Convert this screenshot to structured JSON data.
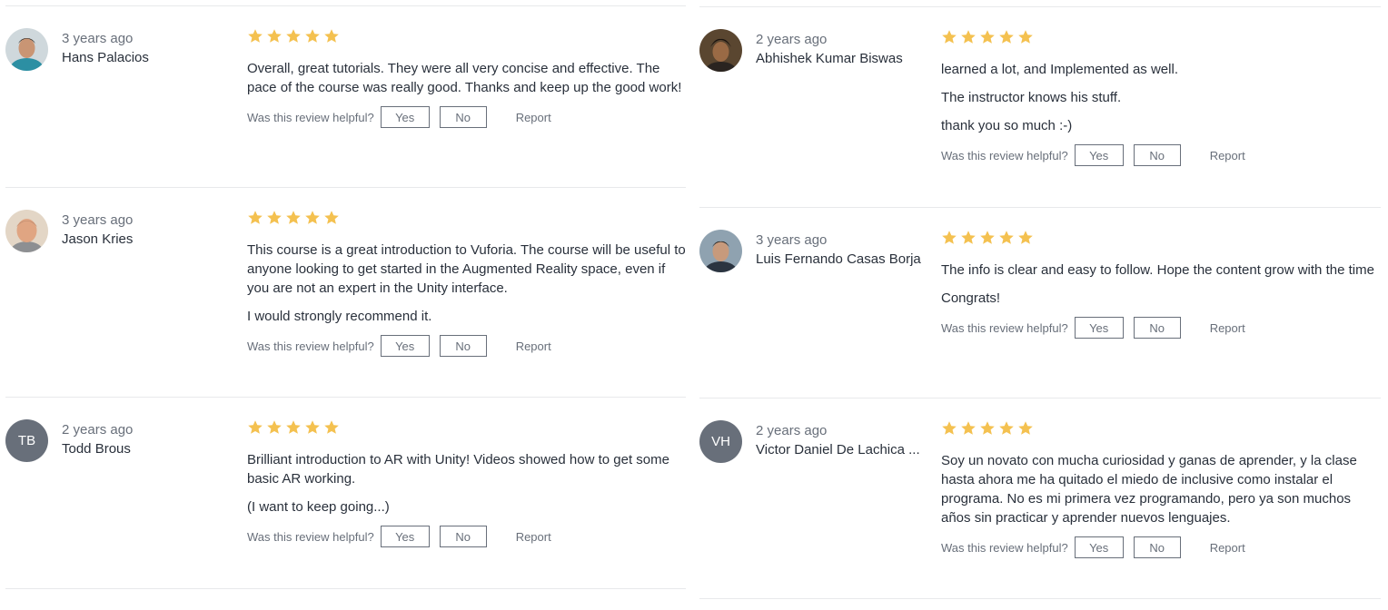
{
  "helpful": {
    "question": "Was this review helpful?",
    "yes": "Yes",
    "no": "No",
    "report": "Report"
  },
  "colors": {
    "star": "#f4c150",
    "initials_bg": "#686f7a",
    "divider": "#e8e9eb"
  },
  "left_reviews": [
    {
      "date": "3 years ago",
      "name": "Hans Palacios",
      "rating": 5,
      "avatar": "photo",
      "paragraphs": [
        "Overall, great tutorials. They were all very concise and effective. The pace of the course was really good. Thanks and keep up the good work!"
      ]
    },
    {
      "date": "3 years ago",
      "name": "Jason Kries",
      "rating": 5,
      "avatar": "photo",
      "paragraphs": [
        "This course is a great introduction to Vuforia. The course will be useful to anyone looking to get started in the Augmented Reality space, even if you are not an expert in the Unity interface.",
        "I would strongly recommend it."
      ]
    },
    {
      "date": "2 years ago",
      "name": "Todd Brous",
      "rating": 5,
      "avatar": "initials",
      "initials": "TB",
      "paragraphs": [
        "Brilliant introduction to AR with Unity! Videos showed how to get some basic AR working.",
        "(I want to keep going...)"
      ]
    }
  ],
  "right_reviews": [
    {
      "date": "2 years ago",
      "name": "Abhishek Kumar Biswas",
      "rating": 5,
      "avatar": "photo",
      "paragraphs": [
        "learned a lot, and Implemented as well.",
        "The instructor knows his stuff.",
        "thank you so much :-)"
      ]
    },
    {
      "date": "3 years ago",
      "name": "Luis Fernando Casas Borja",
      "rating": 5,
      "avatar": "photo",
      "paragraphs": [
        "The info is clear and easy to follow. Hope the content grow with the time",
        "Congrats!"
      ]
    },
    {
      "date": "2 years ago",
      "name": "Victor Daniel De Lachica ...",
      "rating": 5,
      "avatar": "initials",
      "initials": "VH",
      "paragraphs": [
        "Soy un novato con mucha curiosidad y ganas de aprender, y la clase hasta ahora me ha quitado el miedo de inclusive como instalar el programa. No es mi primera vez programando, pero ya son muchos años sin practicar y aprender nuevos lenguajes."
      ]
    }
  ]
}
